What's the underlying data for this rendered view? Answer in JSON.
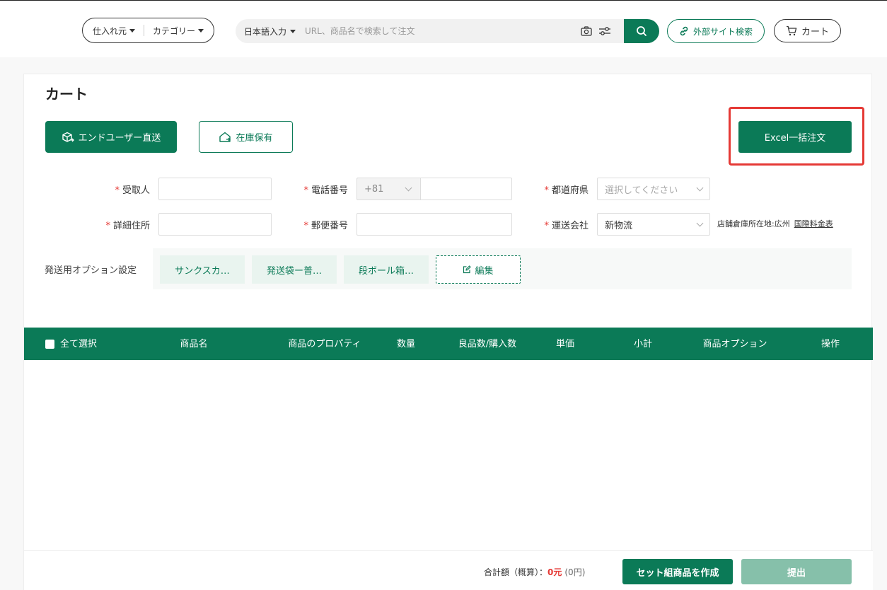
{
  "header": {
    "supplier_label": "仕入れ元",
    "category_label": "カテゴリー",
    "search": {
      "lang_label": "日本語入力",
      "placeholder": "URL、商品名で検索して注文"
    },
    "external_search_label": "外部サイト検索",
    "cart_label": "カート"
  },
  "page": {
    "title": "カート",
    "mode_enduser_label": "エンドユーザー直送",
    "mode_stock_label": "在庫保有",
    "excel_label": "Excel一括注文"
  },
  "form": {
    "required_mark": "*",
    "recipient_label": "受取人",
    "phone_label": "電話番号",
    "phone_code": "+81",
    "prefecture_label": "都道府県",
    "prefecture_placeholder": "選択してください",
    "address_label": "詳細住所",
    "postal_label": "郵便番号",
    "carrier_label": "運送会社",
    "carrier_value": "新物流",
    "warehouse_text": "店舗倉庫所在地:広州",
    "rate_link": "国際料金表"
  },
  "options": {
    "label": "発送用オプション設定",
    "chips": [
      "サンクスカ…",
      "発送袋ー普…",
      "段ボール箱…"
    ],
    "edit_label": "編集"
  },
  "table": {
    "headers": {
      "select_all": "全て選択",
      "product_name": "商品名",
      "property": "商品のプロパティ",
      "quantity": "数量",
      "good_count": "良品数/購入数",
      "unit_price": "単価",
      "subtotal": "小計",
      "product_option": "商品オプション",
      "action": "操作"
    }
  },
  "footer": {
    "total_label": "合計額（概算）：",
    "total_amount": "0元",
    "total_yen": "(0円)",
    "set_button": "セット組商品を作成",
    "submit_button": "提出"
  },
  "colors": {
    "brand": "#0b7a57",
    "brand_light": "#e9f4ef",
    "disabled": "#86c0aa",
    "required": "#e53935",
    "highlight": "#e53935"
  }
}
